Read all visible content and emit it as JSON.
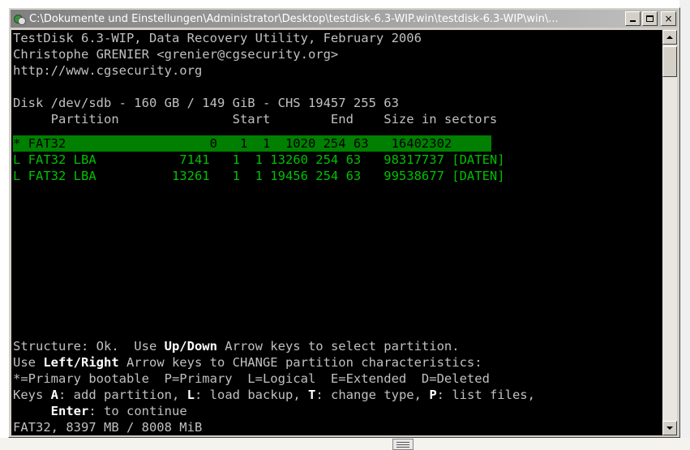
{
  "window": {
    "title": "C:\\Dokumente und Einstellungen\\Administrator\\Desktop\\testdisk-6.3-WIP.win\\testdisk-6.3-WIP\\win\\...",
    "buttons": {
      "minimize": "",
      "maximize": "",
      "close": "×"
    }
  },
  "console": {
    "header": [
      "TestDisk 6.3-WIP, Data Recovery Utility, February 2006",
      "Christophe GRENIER <grenier@cgsecurity.org>",
      "http://www.cgsecurity.org"
    ],
    "disk_line": "Disk /dev/sdb - 160 GB / 149 GiB - CHS 19457 255 63",
    "table_header": "     Partition               Start        End    Size in sectors",
    "rows": [
      {
        "text": "* FAT32                   0   1  1  1020 254 63   16402302",
        "selected": true
      },
      {
        "text": "L FAT32 LBA           7141   1  1 13260 254 63   98317737 [DATEN]",
        "selected": false
      },
      {
        "text": "L FAT32 LBA          13261   1  1 19456 254 63   99538677 [DATEN]",
        "selected": false
      }
    ],
    "status": {
      "l1a": "Structure: Ok.  Use ",
      "l1b": "Up/Down",
      "l1c": " Arrow keys to select partition.",
      "l2a": "Use ",
      "l2b": "Left/Right",
      "l2c": " Arrow keys to CHANGE partition characteristics:",
      "l3": "*=Primary bootable  P=Primary  L=Logical  E=Extended  D=Deleted",
      "l4a": "Keys ",
      "l4b": "A",
      "l4c": ": add partition, ",
      "l4d": "L",
      "l4e": ": load backup, ",
      "l4f": "T",
      "l4g": ": change type, ",
      "l4h": "P",
      "l4i": ": list files,",
      "l5a": "     ",
      "l5b": "Enter",
      "l5c": ": to continue",
      "l6": "FAT32, 8397 MB / 8008 MiB"
    }
  },
  "colors": {
    "console_bg": "#000000",
    "console_text": "#c0c0c0",
    "partition_text": "#00c000",
    "selection_bg": "#007f00",
    "titlebar_inactive": "#808080"
  }
}
